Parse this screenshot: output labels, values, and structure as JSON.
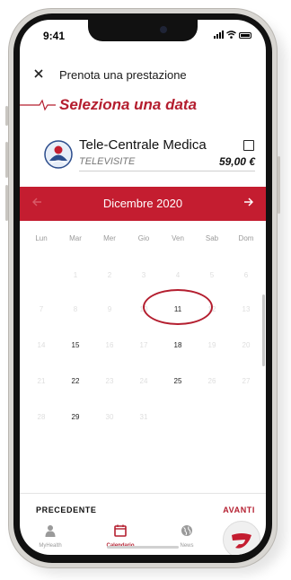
{
  "status_bar": {
    "time": "9:41"
  },
  "header": {
    "close_icon": "close-icon",
    "title": "Prenota una prestazione"
  },
  "section": {
    "icon": "heartbeat-line-icon",
    "title": "Seleziona una data"
  },
  "service": {
    "logo_icon": "medical-logo",
    "name": "Tele-Centrale Medica",
    "subtitle": "TELEVISITE",
    "price": "59,00 €",
    "checkbox_checked": false
  },
  "calendar": {
    "month_label": "Dicembre 2020",
    "prev_icon": "arrow-left-icon",
    "next_icon": "arrow-right-icon",
    "weekdays": [
      "Lun",
      "Mar",
      "Mer",
      "Gio",
      "Ven",
      "Sab",
      "Dom"
    ],
    "weeks": [
      [
        "",
        "1",
        "2",
        "3",
        "4",
        "5",
        "6"
      ],
      [
        "7",
        "8",
        "9",
        "10",
        "11",
        "12",
        "13"
      ],
      [
        "14",
        "15",
        "16",
        "17",
        "18",
        "19",
        "20"
      ],
      [
        "21",
        "22",
        "23",
        "24",
        "25",
        "26",
        "27"
      ],
      [
        "28",
        "29",
        "30",
        "31",
        "",
        "",
        ""
      ]
    ],
    "available_days": [
      "11",
      "15",
      "18",
      "22",
      "25",
      "29"
    ],
    "highlighted_day": "11"
  },
  "footer": {
    "prev_label": "PRECEDENTE",
    "next_label": "AVANTI"
  },
  "tabbar": {
    "items": [
      {
        "label": "MyHealth",
        "icon": "person-icon",
        "active": false
      },
      {
        "label": "Calendario",
        "icon": "calendar-icon",
        "active": true
      },
      {
        "label": "News",
        "icon": "globe-icon",
        "active": false
      }
    ],
    "fab_icon": "brand-logo-icon"
  },
  "colors": {
    "accent": "#c41d30",
    "text": "#111111",
    "muted": "#9a9a9a",
    "disabled": "#dedede"
  }
}
